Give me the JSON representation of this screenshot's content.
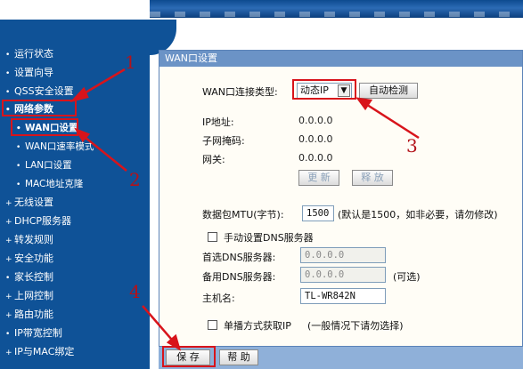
{
  "sidebar": {
    "items": [
      {
        "label": "运行状态",
        "bullet": "•"
      },
      {
        "label": "设置向导",
        "bullet": "•"
      },
      {
        "label": "QSS安全设置",
        "bullet": "•"
      },
      {
        "label": "网络参数",
        "bullet": "•"
      },
      {
        "label": "WAN口设置",
        "bullet": "•"
      },
      {
        "label": "WAN口速率模式",
        "bullet": "•"
      },
      {
        "label": "LAN口设置",
        "bullet": "•"
      },
      {
        "label": "MAC地址克隆",
        "bullet": "•"
      },
      {
        "label": "无线设置",
        "bullet": "+"
      },
      {
        "label": "DHCP服务器",
        "bullet": "+"
      },
      {
        "label": "转发规则",
        "bullet": "+"
      },
      {
        "label": "安全功能",
        "bullet": "+"
      },
      {
        "label": "家长控制",
        "bullet": "•"
      },
      {
        "label": "上网控制",
        "bullet": "+"
      },
      {
        "label": "路由功能",
        "bullet": "+"
      },
      {
        "label": "IP带宽控制",
        "bullet": "•"
      },
      {
        "label": "IP与MAC绑定",
        "bullet": "+"
      }
    ]
  },
  "panel": {
    "title": "WAN口设置",
    "wan_type_label": "WAN口连接类型:",
    "wan_type_value": "动态IP",
    "auto_detect_button": "自动检测",
    "ip_label": "IP地址:",
    "ip_value": "0.0.0.0",
    "mask_label": "子网掩码:",
    "mask_value": "0.0.0.0",
    "gateway_label": "网关:",
    "gateway_value": "0.0.0.0",
    "renew_button": "更 新",
    "release_button": "释 放",
    "mtu_label": "数据包MTU(字节):",
    "mtu_value": "1500",
    "mtu_hint": "(默认是1500，如非必要，请勿修改)",
    "manual_dns_label": "手动设置DNS服务器",
    "primary_dns_label": "首选DNS服务器:",
    "primary_dns_value": "0.0.0.0",
    "secondary_dns_label": "备用DNS服务器:",
    "secondary_dns_value": "0.0.0.0",
    "secondary_dns_hint": "(可选)",
    "hostname_label": "主机名:",
    "hostname_value": "TL-WR842N",
    "unicast_label": "单播方式获取IP",
    "unicast_hint": "(一般情况下请勿选择)"
  },
  "footer": {
    "save_button": "保 存",
    "help_button": "帮 助"
  },
  "annotations": {
    "n1": "1",
    "n2": "2",
    "n3": "3",
    "n4": "4"
  },
  "colors": {
    "sidebar_bg": "#0f5297",
    "panel_header": "#6b93c6",
    "annotation_red": "#d8141b"
  }
}
